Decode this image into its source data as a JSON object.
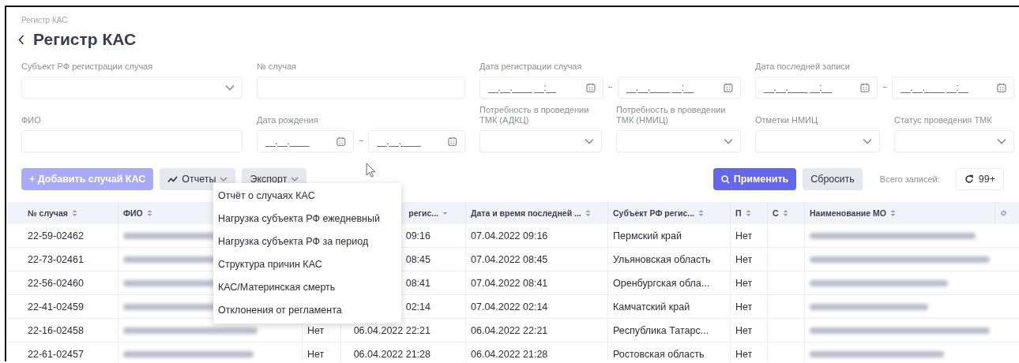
{
  "breadcrumb": "Регистр КАС",
  "title": "Регистр КАС",
  "filters": [
    {
      "kind": "select",
      "label": "Субъект РФ регистрации случая"
    },
    {
      "kind": "text",
      "label": "№ случая"
    },
    {
      "kind": "range",
      "label": "Дата регистрации случая",
      "placeholders": [
        "__.__.____ __:__",
        "__.__.____ __:__"
      ]
    },
    {
      "kind": "range",
      "label": "Дата последней записи",
      "placeholders": [
        "__.__.____ __:__",
        "__.__.____ __:__"
      ]
    },
    {
      "kind": "text",
      "label": "ФИО"
    },
    {
      "kind": "range",
      "label": "Дата рождения",
      "placeholders": [
        "__.__.____",
        "__.__.____"
      ]
    },
    {
      "kind": "select",
      "label": "Потребность в проведении ТМК (АДКЦ)"
    },
    {
      "kind": "select",
      "label": "Потребность в проведении ТМК (НМИЦ)"
    },
    {
      "kind": "select",
      "label": "Отметки НМИЦ"
    },
    {
      "kind": "select",
      "label": "Статус проведения ТМК"
    }
  ],
  "toolbar": {
    "left": [
      {
        "kind": "primary",
        "label": "+ Добавить случай КАС",
        "disabled": true
      },
      {
        "kind": "dropdown",
        "label": "Отчеты",
        "disabled": false,
        "expanded": true,
        "menu": [
          "Отчёт о случаях КАС",
          "Нагрузка субъекта РФ ежедневный",
          "Нагрузка субъекта РФ за период",
          "Структура причин КАС",
          "КАС/Материнская смерть",
          "Отклонения от регламента"
        ]
      },
      {
        "kind": "dropdown",
        "label": "Экспорт",
        "disabled": false,
        "expanded": false
      }
    ],
    "right": [
      {
        "kind": "primary",
        "label": "Применить",
        "disabled": false
      },
      {
        "kind": "secondary",
        "label": "Сбросить",
        "disabled": false
      }
    ],
    "total_label": "Всего записей:",
    "total": "99+"
  },
  "table": {
    "columns": [
      {
        "label": "№ случая",
        "sorted": false
      },
      {
        "label": "ФИО",
        "sorted": false
      },
      {
        "label": "регис...",
        "sorted": true
      },
      {
        "label": "Дата и время последней ...",
        "sorted": false
      },
      {
        "label": "Субъект РФ регис...",
        "sorted": false
      },
      {
        "label": "П",
        "sorted": false
      },
      {
        "label": "С",
        "sorted": false
      },
      {
        "label": "Наименование МО",
        "sorted": false
      }
    ],
    "rows": [
      {
        "case_no": "22-59-02462",
        "column_4": "09:16",
        "last_entry": "07.04.2022 09:16",
        "region": "Пермский край",
        "p": "Нет"
      },
      {
        "case_no": "22-73-02461",
        "column_4": "08:45",
        "last_entry": "07.04.2022 08:45",
        "region": "Ульяновская область",
        "p": "Нет"
      },
      {
        "case_no": "22-56-02460",
        "column_4": "08:41",
        "last_entry": "07.04.2022 08:41",
        "region": "Оренбургская обла...",
        "p": "Нет"
      },
      {
        "case_no": "22-41-02459",
        "column_4": "02:14",
        "last_entry": "07.04.2022 02:14",
        "region": "Камчатский край",
        "p": "Нет"
      },
      {
        "case_no": "22-16-02458",
        "column_3": "Нет",
        "column_4": "06.04.2022 22:21",
        "last_entry": "06.04.2022 22:21",
        "region": "Республика Татарс...",
        "p": "Нет"
      },
      {
        "case_no": "22-61-02457",
        "column_3": "Нет",
        "column_4": "06.04.2022 21:28",
        "last_entry": "06.04.2022 21:28",
        "region": "Ростовская область",
        "p": "Нет"
      }
    ]
  }
}
